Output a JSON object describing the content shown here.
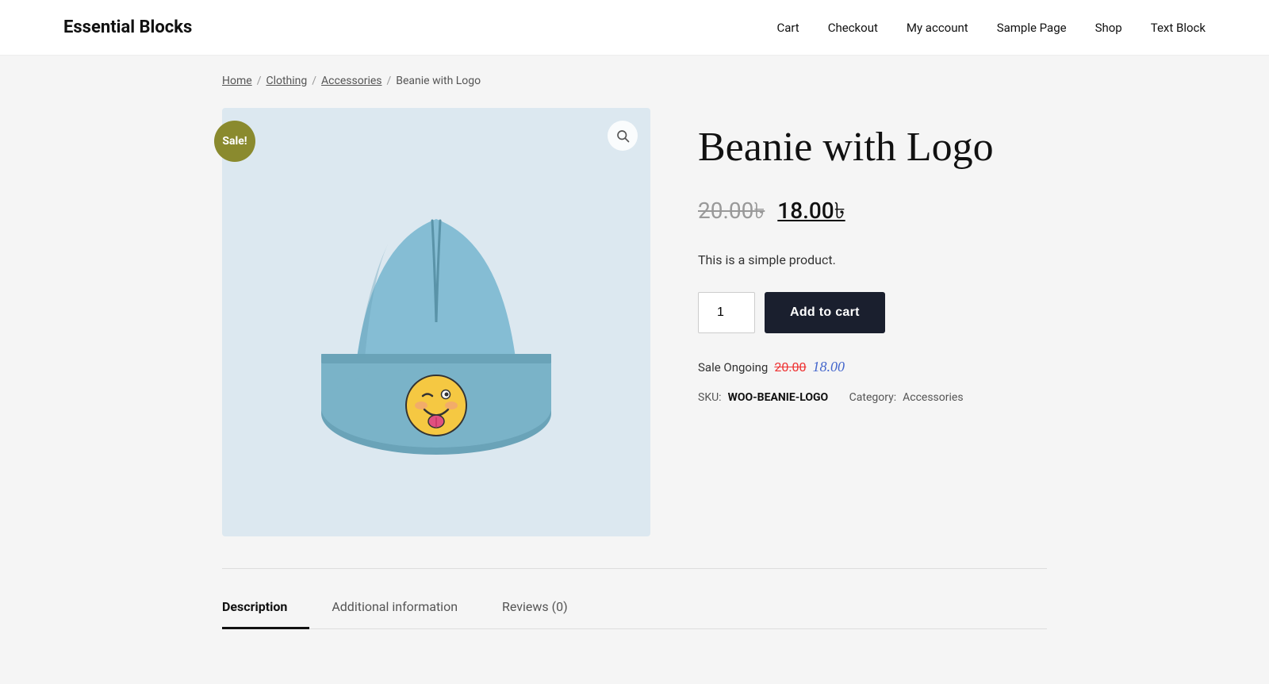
{
  "site": {
    "title": "Essential Blocks"
  },
  "nav": {
    "items": [
      {
        "label": "Cart",
        "href": "#"
      },
      {
        "label": "Checkout",
        "href": "#"
      },
      {
        "label": "My account",
        "href": "#"
      },
      {
        "label": "Sample Page",
        "href": "#"
      },
      {
        "label": "Shop",
        "href": "#"
      },
      {
        "label": "Text Block",
        "href": "#"
      }
    ]
  },
  "breadcrumb": {
    "home": "Home",
    "clothing": "Clothing",
    "accessories": "Accessories",
    "current": "Beanie with Logo"
  },
  "product": {
    "title": "Beanie with Logo",
    "sale_badge": "Sale!",
    "price_original": "20.00৳",
    "price_sale": "18.00৳",
    "description": "This is a simple product.",
    "quantity_value": "1",
    "add_to_cart_label": "Add to cart",
    "sale_ongoing_label": "Sale Ongoing",
    "sale_ongoing_original": "20.00",
    "sale_ongoing_current": "18.00",
    "sku_label": "SKU:",
    "sku_value": "WOO-BEANIE-LOGO",
    "category_label": "Category:",
    "category_value": "Accessories"
  },
  "tabs": [
    {
      "label": "Description",
      "active": true
    },
    {
      "label": "Additional information",
      "active": false
    },
    {
      "label": "Reviews (0)",
      "active": false
    }
  ],
  "icons": {
    "zoom": "🔍",
    "search": "⌕"
  }
}
